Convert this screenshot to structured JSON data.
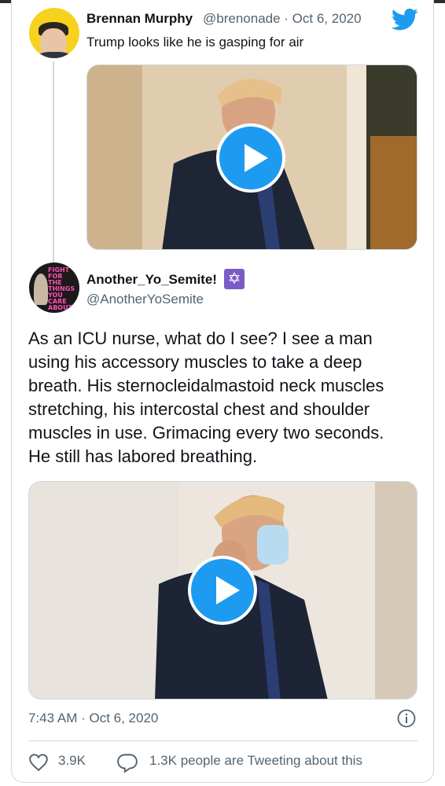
{
  "parent_tweet": {
    "display_name": "Brennan Murphy",
    "handle_and_date": "@brenonade · Oct 6, 2020",
    "text": "Trump looks like he is gasping for air",
    "media": {
      "type": "video",
      "icon": "play-icon"
    }
  },
  "main_tweet": {
    "display_name": "Another_Yo_Semite!",
    "name_badge": "✡",
    "handle": "@AnotherYoSemite",
    "avatar_poster_text": "FIGHT\nFOR\nTHE\nTHINGS\nYOU\nCARE\nABOUT",
    "body_lines": [
      "As an ICU nurse, what do I see? I see a man",
      "using his accessory muscles to take a deep",
      "breath. His sternocleidalmastoid neck muscles",
      "stretching, his intercostal chest and shoulder",
      "muscles in use.   Grimacing every two seconds.",
      "He still has labored breathing."
    ],
    "media": {
      "type": "video",
      "icon": "play-icon"
    },
    "timestamp": "7:43 AM · Oct 6, 2020",
    "likes": "3.9K",
    "tweeting_text": "1.3K people are Tweeting about this"
  },
  "colors": {
    "brand_blue": "#1d9bf0",
    "secondary_text": "#536471",
    "border": "#cfd9de"
  },
  "icons": [
    "twitter-bird-icon",
    "play-icon",
    "info-icon",
    "heart-icon",
    "reply-bubble-icon",
    "star-of-david-icon"
  ]
}
